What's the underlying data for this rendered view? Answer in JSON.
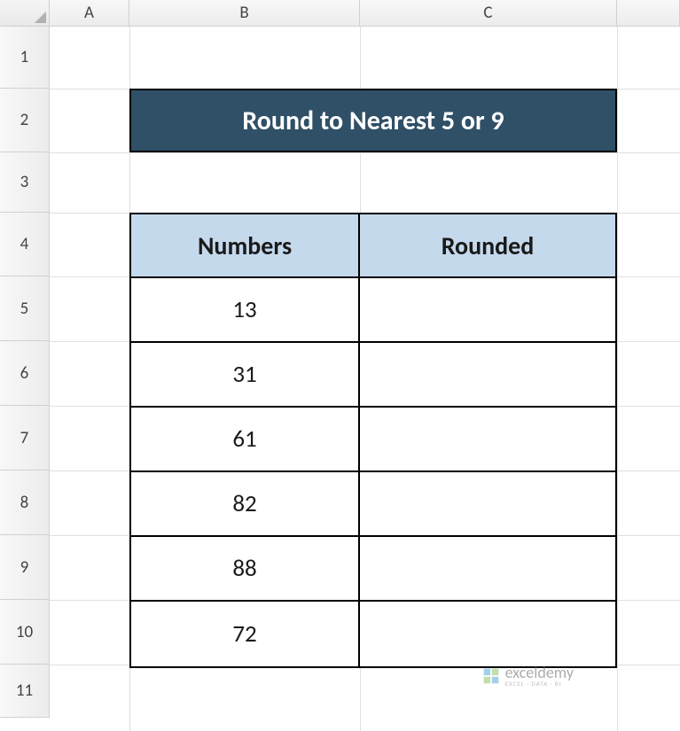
{
  "columns": [
    "A",
    "B",
    "C"
  ],
  "rows": [
    "1",
    "2",
    "3",
    "4",
    "5",
    "6",
    "7",
    "8",
    "9",
    "10",
    "11"
  ],
  "banner": {
    "title": "Round to Nearest 5 or 9"
  },
  "table": {
    "headers": {
      "numbers": "Numbers",
      "rounded": "Rounded"
    },
    "data": [
      {
        "number": "13",
        "rounded": ""
      },
      {
        "number": "31",
        "rounded": ""
      },
      {
        "number": "61",
        "rounded": ""
      },
      {
        "number": "82",
        "rounded": ""
      },
      {
        "number": "88",
        "rounded": ""
      },
      {
        "number": "72",
        "rounded": ""
      }
    ]
  },
  "watermark": {
    "main": "exceldemy",
    "sub": "EXCEL · DATA · BI"
  }
}
